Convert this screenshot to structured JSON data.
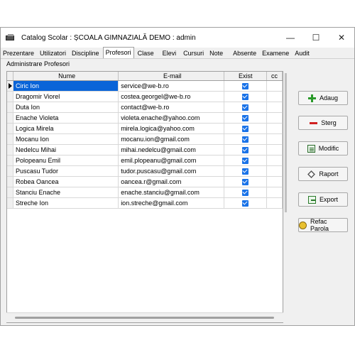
{
  "window": {
    "title": "Catalog Scolar : ȘCOALA GIMNAZIALĂ DEMO : admin",
    "minimize_glyph": "—",
    "maximize_glyph": "☐",
    "close_glyph": "✕"
  },
  "menu": {
    "tabs": [
      {
        "label": "Prezentare"
      },
      {
        "label": "Utilizatori"
      },
      {
        "label": "Discipline"
      },
      {
        "label": "Profesori"
      },
      {
        "label": "Clase"
      },
      {
        "label": "Elevi"
      },
      {
        "label": "Cursuri"
      },
      {
        "label": "Note"
      },
      {
        "label": "Absente"
      },
      {
        "label": "Examene"
      },
      {
        "label": "Audit"
      }
    ],
    "active_tab": "Profesori"
  },
  "section_label": "Administrare Profesori",
  "grid": {
    "columns": [
      "Nume",
      "E-mail",
      "Exist",
      "cc"
    ],
    "rows": [
      {
        "name": "Ciric Ion",
        "email": "service@we-b.ro",
        "exist": true
      },
      {
        "name": "Dragomir Viorel",
        "email": "costea.georgel@we-b.ro",
        "exist": true
      },
      {
        "name": "Duta Ion",
        "email": "contact@we-b.ro",
        "exist": true
      },
      {
        "name": "Enache Violeta",
        "email": "violeta.enache@yahoo.com",
        "exist": true
      },
      {
        "name": "Logica Mirela",
        "email": "mirela.logica@yahoo.com",
        "exist": true
      },
      {
        "name": "Mocanu Ion",
        "email": "mocanu.ion@gmail.com",
        "exist": true
      },
      {
        "name": "Nedelcu Mihai",
        "email": "mihai.nedelcu@gmail.com",
        "exist": true
      },
      {
        "name": "Polopeanu Emil",
        "email": "emil.plopeanu@gmail.com",
        "exist": true
      },
      {
        "name": "Puscasu Tudor",
        "email": "tudor.puscasu@gmail.com",
        "exist": true
      },
      {
        "name": "Robea Oancea",
        "email": "oancea.r@gmail.com",
        "exist": true
      },
      {
        "name": "Stanciu Enache",
        "email": "enache.stanciu@gmail.com",
        "exist": true
      },
      {
        "name": "Streche Ion",
        "email": "ion.streche@gmail.com",
        "exist": true
      }
    ],
    "selected_row": "Ciric Ion"
  },
  "actions": {
    "add": "Adaug",
    "delete": "Sterg",
    "modify": "Modific",
    "report": "Raport",
    "export": "Export",
    "reset_password": "Refac Parola"
  },
  "colors": {
    "selection": "#0a64d8",
    "checkbox": "#1a73e8",
    "add_icon": "#2a9a2a",
    "delete_icon": "#d02020"
  }
}
